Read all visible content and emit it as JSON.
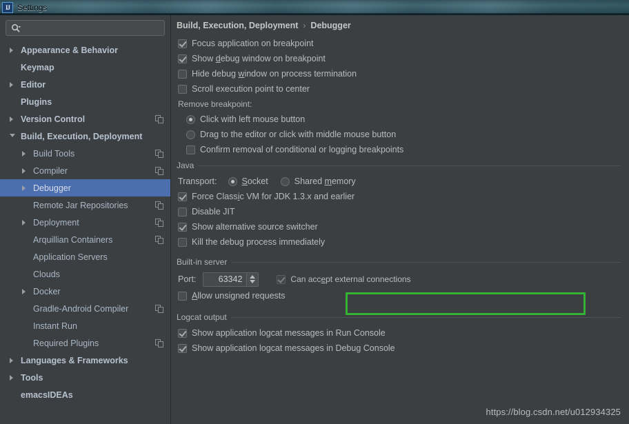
{
  "window": {
    "title": "Settings",
    "icon": "intellij-idea-icon"
  },
  "sidebar": {
    "search": {
      "value": "",
      "placeholder": "",
      "icon": "search-icon"
    },
    "items": [
      {
        "label": "Appearance & Behavior",
        "level": 0,
        "bold": true,
        "arrow": "right",
        "copy": false,
        "selected": false
      },
      {
        "label": "Keymap",
        "level": 0,
        "bold": true,
        "arrow": "none",
        "copy": false,
        "selected": false
      },
      {
        "label": "Editor",
        "level": 0,
        "bold": true,
        "arrow": "right",
        "copy": false,
        "selected": false
      },
      {
        "label": "Plugins",
        "level": 0,
        "bold": true,
        "arrow": "none",
        "copy": false,
        "selected": false
      },
      {
        "label": "Version Control",
        "level": 0,
        "bold": true,
        "arrow": "right",
        "copy": true,
        "selected": false
      },
      {
        "label": "Build, Execution, Deployment",
        "level": 0,
        "bold": true,
        "arrow": "down",
        "copy": false,
        "selected": false
      },
      {
        "label": "Build Tools",
        "level": 1,
        "bold": false,
        "arrow": "right",
        "copy": true,
        "selected": false
      },
      {
        "label": "Compiler",
        "level": 1,
        "bold": false,
        "arrow": "right",
        "copy": true,
        "selected": false
      },
      {
        "label": "Debugger",
        "level": 1,
        "bold": false,
        "arrow": "right",
        "copy": false,
        "selected": true
      },
      {
        "label": "Remote Jar Repositories",
        "level": 1,
        "bold": false,
        "arrow": "none",
        "copy": true,
        "selected": false
      },
      {
        "label": "Deployment",
        "level": 1,
        "bold": false,
        "arrow": "right",
        "copy": true,
        "selected": false
      },
      {
        "label": "Arquillian Containers",
        "level": 1,
        "bold": false,
        "arrow": "none",
        "copy": true,
        "selected": false
      },
      {
        "label": "Application Servers",
        "level": 1,
        "bold": false,
        "arrow": "none",
        "copy": false,
        "selected": false
      },
      {
        "label": "Clouds",
        "level": 1,
        "bold": false,
        "arrow": "none",
        "copy": false,
        "selected": false
      },
      {
        "label": "Docker",
        "level": 1,
        "bold": false,
        "arrow": "right",
        "copy": false,
        "selected": false
      },
      {
        "label": "Gradle-Android Compiler",
        "level": 1,
        "bold": false,
        "arrow": "none",
        "copy": true,
        "selected": false
      },
      {
        "label": "Instant Run",
        "level": 1,
        "bold": false,
        "arrow": "none",
        "copy": false,
        "selected": false
      },
      {
        "label": "Required Plugins",
        "level": 1,
        "bold": false,
        "arrow": "none",
        "copy": true,
        "selected": false
      },
      {
        "label": "Languages & Frameworks",
        "level": 0,
        "bold": true,
        "arrow": "right",
        "copy": false,
        "selected": false
      },
      {
        "label": "Tools",
        "level": 0,
        "bold": true,
        "arrow": "right",
        "copy": false,
        "selected": false
      },
      {
        "label": "emacsIDEAs",
        "level": 0,
        "bold": true,
        "arrow": "none",
        "copy": false,
        "selected": false
      }
    ]
  },
  "breadcrumb": {
    "root": "Build, Execution, Deployment",
    "separator": "›",
    "current": "Debugger"
  },
  "main": {
    "top_checkboxes": [
      {
        "label": "Focus application on breakpoint",
        "checked": true,
        "mnemonic": ""
      },
      {
        "label": "Show debug window on breakpoint",
        "checked": true,
        "mnemonic": "d"
      },
      {
        "label": "Hide debug window on process termination",
        "checked": false,
        "mnemonic": "w"
      },
      {
        "label": "Scroll execution point to center",
        "checked": false,
        "mnemonic": ""
      }
    ],
    "remove_breakpoint": {
      "label": "Remove breakpoint:",
      "radios": [
        {
          "label": "Click with left mouse button",
          "checked": true
        },
        {
          "label": "Drag to the editor or click with middle mouse button",
          "checked": false
        }
      ],
      "confirm": {
        "label": "Confirm removal of conditional or logging breakpoints",
        "checked": false
      }
    },
    "java": {
      "group": "Java",
      "transport_label": "Transport:",
      "transport_options": [
        {
          "label": "Socket",
          "checked": true,
          "mnemonic": "S"
        },
        {
          "label": "Shared memory",
          "checked": false,
          "mnemonic": "m"
        }
      ],
      "checkboxes": [
        {
          "label": "Force Classic VM for JDK 1.3.x and earlier",
          "checked": true,
          "mnemonic": "i"
        },
        {
          "label": "Disable JIT",
          "checked": false,
          "mnemonic": ""
        },
        {
          "label": "Show alternative source switcher",
          "checked": true,
          "mnemonic": ""
        },
        {
          "label": "Kill the debug process immediately",
          "checked": false,
          "mnemonic": ""
        }
      ]
    },
    "builtin_server": {
      "group": "Built-in server",
      "port_label": "Port:",
      "port_value": "63342",
      "external": {
        "label": "Can accept external connections",
        "checked": true,
        "disabled": true,
        "mnemonic": "e"
      },
      "unsigned": {
        "label": "Allow unsigned requests",
        "checked": false,
        "mnemonic": "A"
      }
    },
    "logcat": {
      "group": "Logcat output",
      "checkboxes": [
        {
          "label": "Show application logcat messages in Run Console",
          "checked": true
        },
        {
          "label": "Show application logcat messages in Debug Console",
          "checked": true
        }
      ]
    }
  },
  "annotation": {
    "name": "green-highlight-rectangle",
    "color": "#35b234"
  },
  "watermark": "https://blog.csdn.net/u012934325",
  "colors": {
    "background": "#3c3f41",
    "selection": "#4b6eaf",
    "text": "#bbbbbb",
    "tree_text": "#a9b7c6",
    "accent_green": "#35b234"
  }
}
